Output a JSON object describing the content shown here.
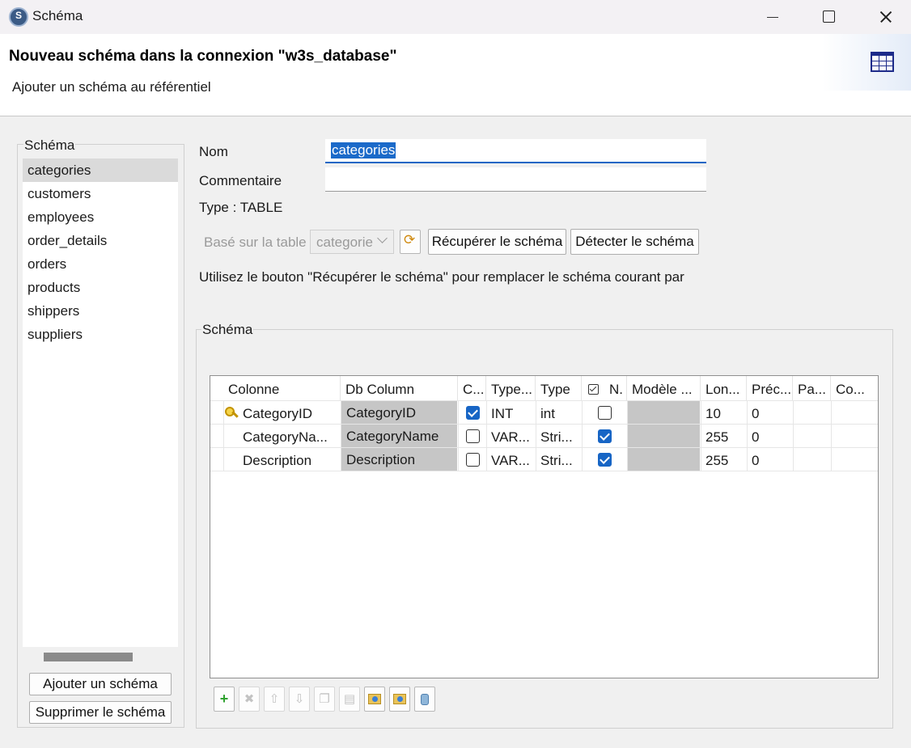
{
  "window": {
    "title": "Schéma"
  },
  "header": {
    "title": "Nouveau schéma dans la connexion \"w3s_database\"",
    "subtitle": "Ajouter un schéma au référentiel"
  },
  "left_panel": {
    "legend": "Schéma",
    "items": [
      "categories",
      "customers",
      "employees",
      "order_details",
      "orders",
      "products",
      "shippers",
      "suppliers"
    ],
    "selected": "categories",
    "add_button": "Ajouter un schéma",
    "remove_button": "Supprimer le schéma"
  },
  "form": {
    "name_label": "Nom",
    "name_value": "categories",
    "comment_label": "Commentaire",
    "comment_value": "",
    "type_text": "Type : TABLE",
    "based_on_label": "Basé sur la table",
    "based_on_value": "categorie",
    "retrieve_button": "Récupérer le schéma",
    "detect_button": "Détecter le schéma",
    "hint": "Utilisez le bouton \"Récupérer le schéma\" pour remplacer le schéma courant par"
  },
  "schema": {
    "legend": "Schéma",
    "headers": [
      "Colonne",
      "Db Column",
      "C...",
      "Type...",
      "Type",
      "N.",
      "Modèle ...",
      "Lon...",
      "Préc...",
      "Pa...",
      "Co..."
    ],
    "rows": [
      {
        "key": true,
        "colonne": "CategoryID",
        "db_column": "CategoryID",
        "c": true,
        "type_db": "INT",
        "type": "int",
        "nullable": false,
        "modele": "",
        "longueur": "10",
        "precision": "0",
        "pa": "",
        "co": ""
      },
      {
        "key": false,
        "colonne": "CategoryNa...",
        "db_column": "CategoryName",
        "c": false,
        "type_db": "VAR...",
        "type": "Stri...",
        "nullable": true,
        "modele": "",
        "longueur": "255",
        "precision": "0",
        "pa": "",
        "co": ""
      },
      {
        "key": false,
        "colonne": "Description",
        "db_column": "Description",
        "c": false,
        "type_db": "VAR...",
        "type": "Stri...",
        "nullable": true,
        "modele": "",
        "longueur": "255",
        "precision": "0",
        "pa": "",
        "co": ""
      }
    ],
    "toolbar": [
      "add-icon",
      "delete-icon",
      "move-up-icon",
      "move-down-icon",
      "copy-icon",
      "paste-icon",
      "import-icon",
      "export-icon",
      "database-icon"
    ]
  },
  "colors": {
    "accent": "#1b6ac9",
    "checkbox": "#1765c5",
    "selection": "#dadada"
  }
}
